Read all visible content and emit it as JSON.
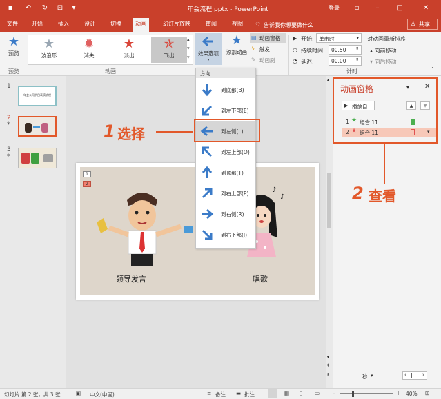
{
  "app": {
    "title": "年会流程.pptx - PowerPoint",
    "login": "登录",
    "share": "共享"
  },
  "tabs": [
    "文件",
    "开始",
    "插入",
    "设计",
    "切换",
    "动画",
    "幻灯片放映",
    "审阅",
    "视图"
  ],
  "tell_me": "告诉我你想要做什么",
  "ribbon": {
    "preview": "预览",
    "preview_group": "预览",
    "animation_group": "动画",
    "timing_group": "计时",
    "gallery": [
      "波浪形",
      "消失",
      "淡出",
      "飞出"
    ],
    "effect_options": "效果选项",
    "add_animation": "添加动画",
    "anim_pane_btn": "动画窗格",
    "trigger": "触发",
    "anim_painter": "动画刷",
    "start_label": "开始:",
    "start_value": "单击时",
    "duration_label": "持续时间:",
    "duration_value": "00.50",
    "delay_label": "延迟:",
    "delay_value": "00.00",
    "reorder": "对动画重新排序",
    "move_earlier": "向前移动",
    "move_later": "向后移动"
  },
  "dropdown": {
    "header": "方向",
    "items": [
      "到底部(B)",
      "到左下部(E)",
      "到左侧(L)",
      "到左上部(O)",
      "到顶部(T)",
      "到右上部(P)",
      "到右侧(R)",
      "到右下部(I)"
    ],
    "selected_index": 2
  },
  "slides": {
    "numbers": [
      "1",
      "2",
      "3"
    ],
    "thumb1_text": "年会公司节目表演流程"
  },
  "slide": {
    "left_caption": "领导发言",
    "right_caption": "唱歌",
    "tag1": "1",
    "tag2": "2"
  },
  "anim_pane": {
    "title": "动画窗格",
    "play": "播放自",
    "rows": [
      {
        "num": "1",
        "name": "组合 11",
        "color": "#4caf50"
      },
      {
        "num": "2",
        "name": "组合 11",
        "color": "#e05050"
      }
    ],
    "seconds": "秒"
  },
  "callouts": {
    "c1_num": "1",
    "c1_text": "选择",
    "c2_num": "2",
    "c2_text": "查看"
  },
  "status": {
    "slide_info": "幻灯片 第 2 张，共 3 张",
    "language": "中文(中国)",
    "notes": "备注",
    "comments": "批注",
    "zoom": "40%"
  },
  "colors": {
    "accent": "#c9402b",
    "callout": "#e2582a",
    "arrow_blue": "#3b7bc8"
  }
}
